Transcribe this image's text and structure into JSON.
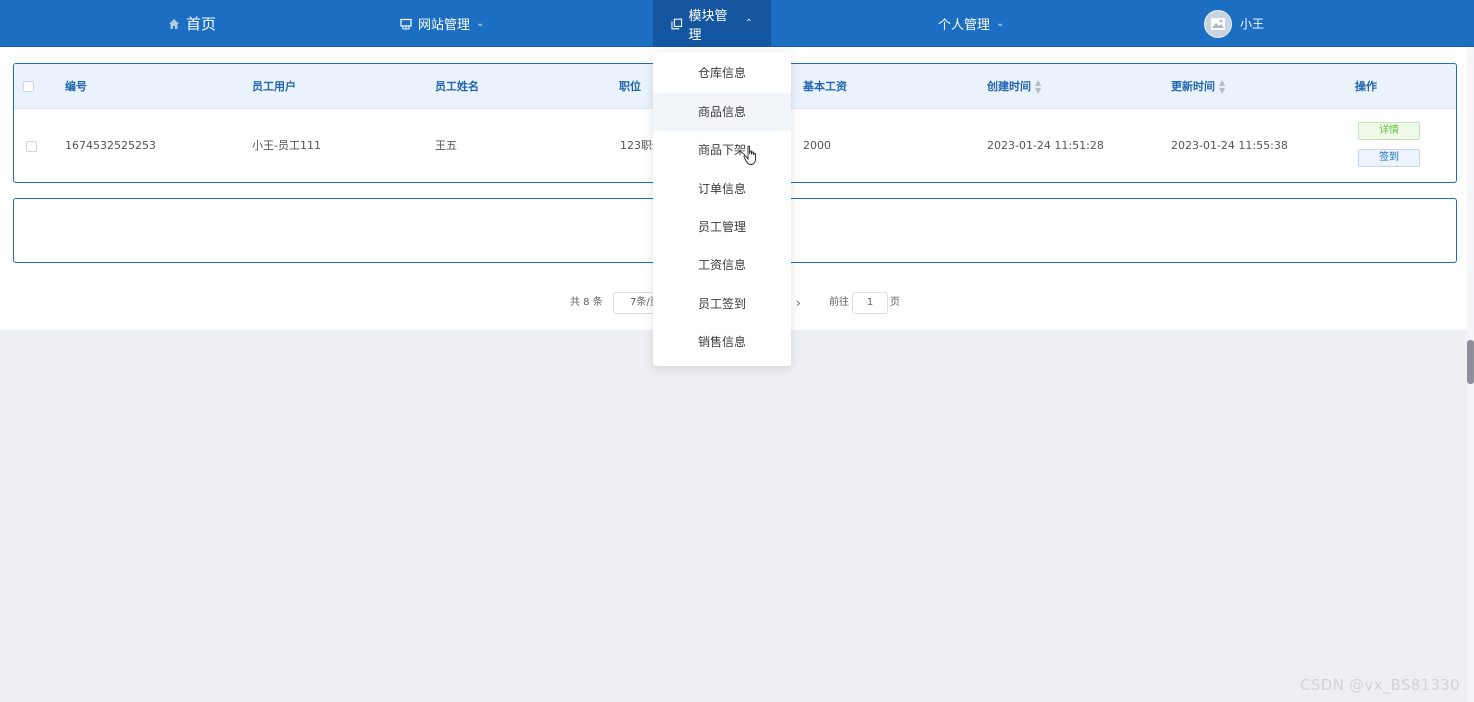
{
  "nav": {
    "home": "首页",
    "site_mgmt": "网站管理",
    "module_mgmt": "模块管理",
    "personal_mgmt": "个人管理",
    "user_name": "小王"
  },
  "table": {
    "headers": {
      "id": "编号",
      "user": "员工用户",
      "name": "员工姓名",
      "position": "职位",
      "salary": "基本工资",
      "created": "创建时间",
      "updated": "更新时间",
      "actions": "操作"
    },
    "rows": [
      {
        "id": "1674532525253",
        "user": "小王-员工111",
        "name": "王五",
        "position": "123职位",
        "salary": "2000",
        "created": "2023-01-24 11:51:28",
        "updated": "2023-01-24 11:55:38",
        "detail_label": "详情",
        "sign_label": "签到"
      }
    ]
  },
  "pagination": {
    "total": "共 8 条",
    "page_size": "7条/页",
    "goto": "前往",
    "page": "1",
    "page_suffix": "页",
    "next": "›"
  },
  "dropdown": {
    "items": [
      "仓库信息",
      "商品信息",
      "商品下架",
      "订单信息",
      "员工管理",
      "工资信息",
      "员工签到",
      "销售信息"
    ]
  },
  "watermark": "CSDN @vx_BS81330",
  "colors": {
    "nav_bg": "#1b6ec2",
    "nav_active": "#1556a0",
    "header_text": "#2266b0",
    "table_border": "#1d6fb8"
  },
  "icons": {
    "home": "home-icon",
    "site": "monitor-icon",
    "module": "copy-icon",
    "chevron": "chevron-down-icon",
    "avatar": "image-icon"
  }
}
